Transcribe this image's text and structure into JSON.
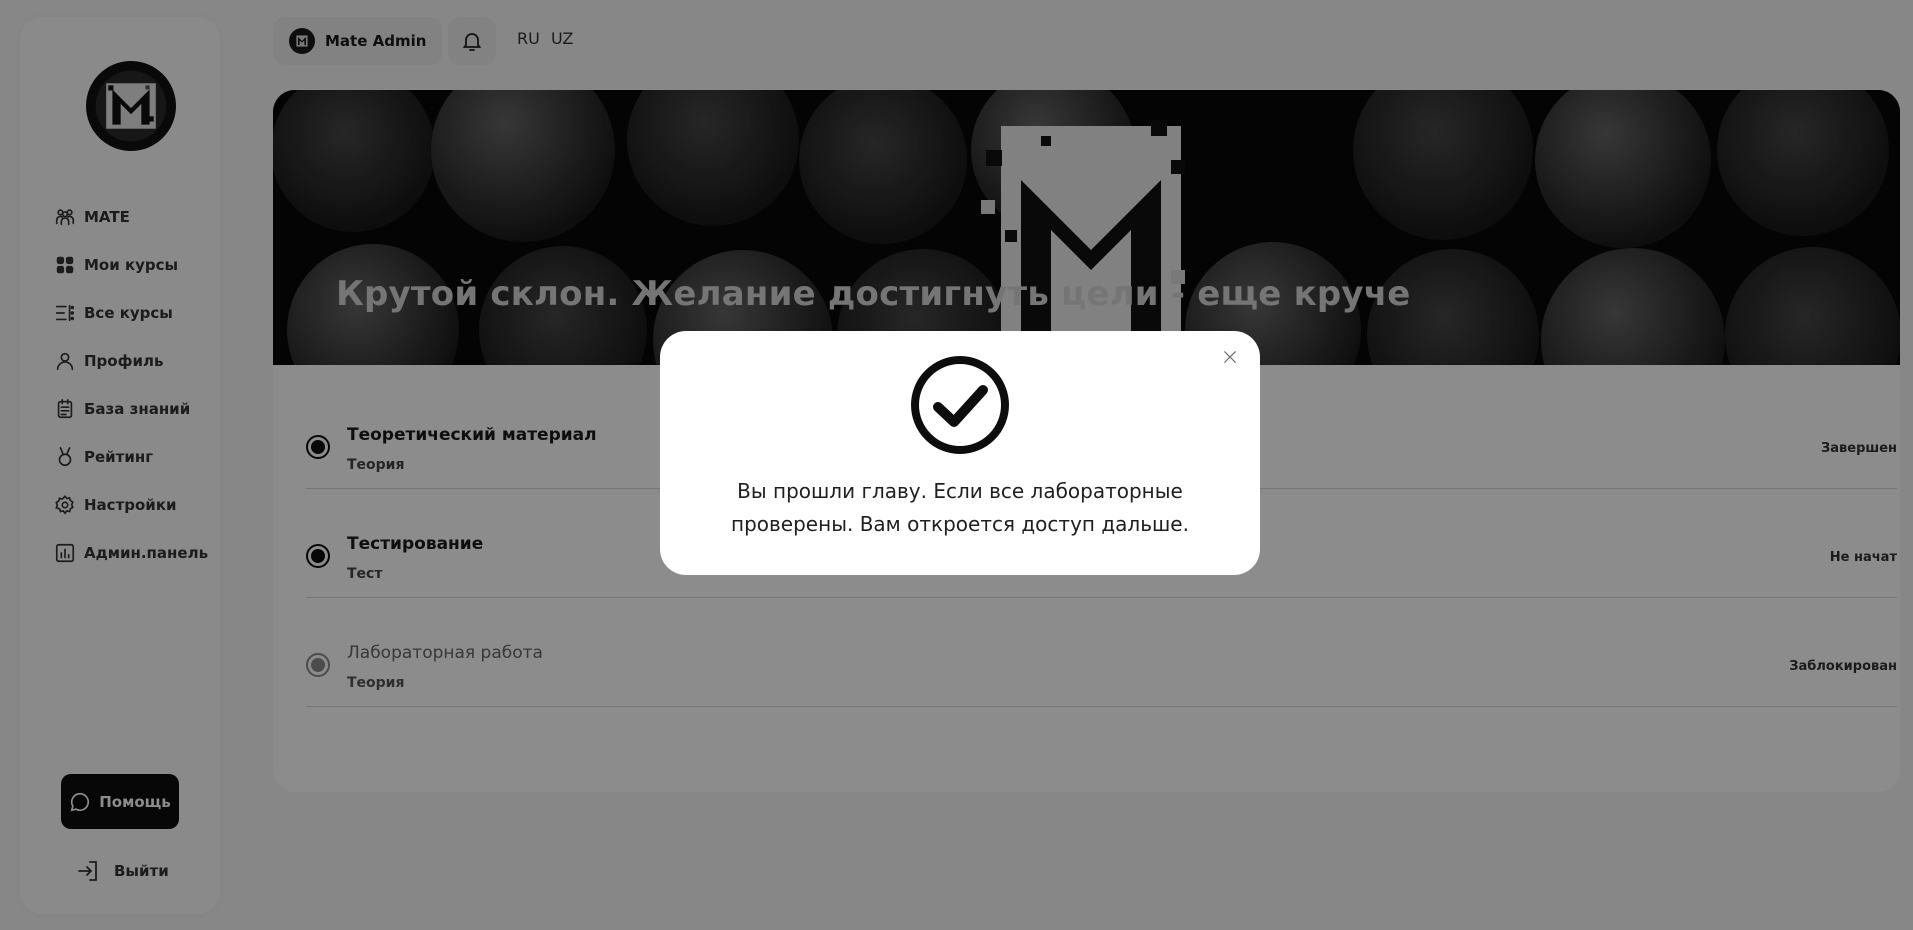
{
  "sidebar": {
    "items": [
      {
        "label": "MATE",
        "icon": "community-icon"
      },
      {
        "label": "Мои курсы",
        "icon": "grid-icon"
      },
      {
        "label": "Все курсы",
        "icon": "list-icon"
      },
      {
        "label": "Профиль",
        "icon": "user-icon"
      },
      {
        "label": "База знаний",
        "icon": "clipboard-icon"
      },
      {
        "label": "Рейтинг",
        "icon": "medal-icon"
      },
      {
        "label": "Настройки",
        "icon": "gear-icon"
      },
      {
        "label": "Админ.панель",
        "icon": "bar-chart-icon"
      }
    ],
    "help_label": "Помощь",
    "logout_label": "Выйти"
  },
  "header": {
    "user_name": "Mate Admin",
    "languages": [
      "RU",
      "UZ"
    ]
  },
  "banner": {
    "title": "Крутой склон. Желание достигнуть цели - еще круче"
  },
  "lessons": [
    {
      "title": "Теоретический материал",
      "type": "Теория",
      "status": "Завершен"
    },
    {
      "title": "Тестирование",
      "type": "Тест",
      "status": "Не начат"
    },
    {
      "title": "Лабораторная работа",
      "type": "Теория",
      "status": "Заблокирован"
    }
  ],
  "modal": {
    "message": "Вы прошли главу. Если все лабораторные проверены. Вам откроется доступ дальше."
  },
  "colors": {
    "accent": "#0d0d0d",
    "background": "#f6f6f6",
    "overlay": "rgba(0,0,0,0.45)"
  }
}
